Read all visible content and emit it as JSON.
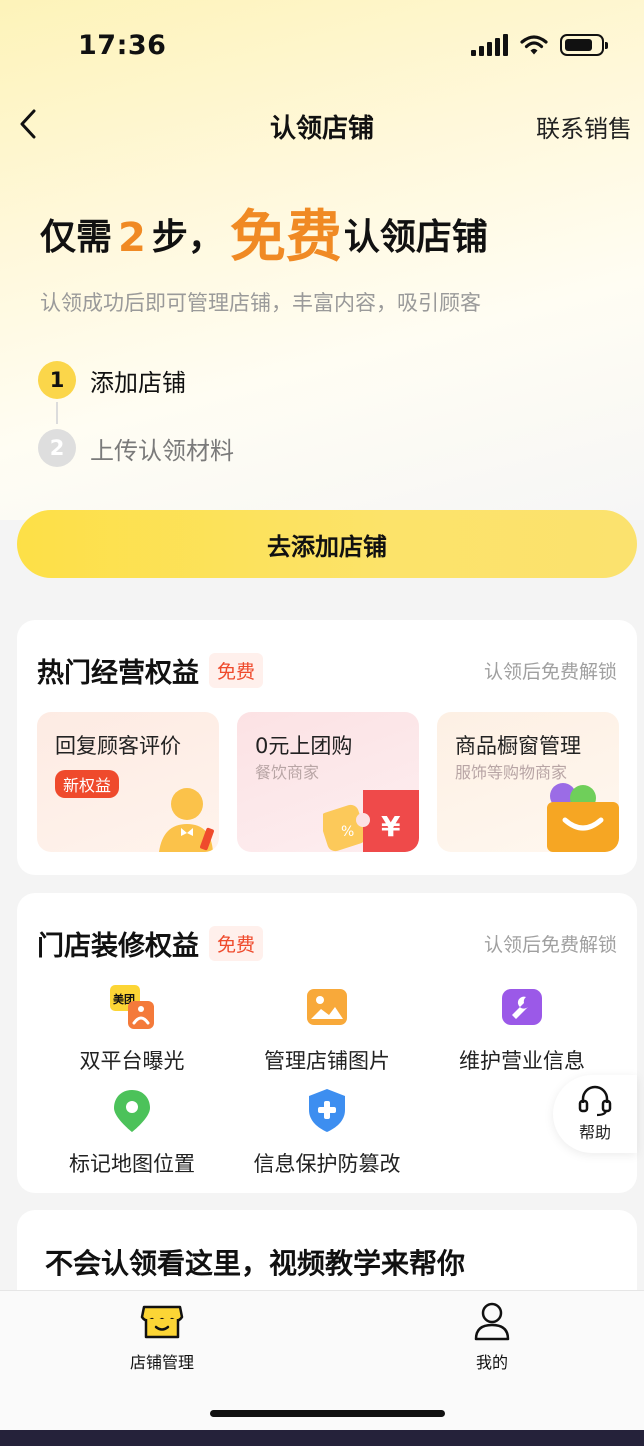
{
  "status_bar": {
    "time": "17:36"
  },
  "nav": {
    "title": "认领店铺",
    "right_action": "联系销售"
  },
  "headline": {
    "prefix": "仅需",
    "steps_count": "2",
    "steps_unit": "步，",
    "highlight": "免费",
    "suffix": "认领店铺"
  },
  "subtitle": "认领成功后即可管理店铺，丰富内容，吸引顾客",
  "steps": [
    {
      "num": "1",
      "label": "添加店铺",
      "active": true
    },
    {
      "num": "2",
      "label": "上传认领材料",
      "active": false
    }
  ],
  "cta_label": "去添加店铺",
  "hot_benefits": {
    "title": "热门经营权益",
    "badge": "免费",
    "right_text": "认领后免费解锁",
    "tiles": [
      {
        "title": "回复顾客评价",
        "badge": "新权益"
      },
      {
        "title": "0元上团购",
        "subtitle": "餐饮商家"
      },
      {
        "title": "商品橱窗管理",
        "subtitle": "服饰等购物商家"
      }
    ],
    "tile_icons": {
      "ticket_symbol": "¥",
      "coupon_symbol": "%"
    }
  },
  "decor_benefits": {
    "title": "门店装修权益",
    "badge": "免费",
    "right_text": "认领后免费解锁",
    "items": [
      {
        "label": "双平台曝光",
        "icon": "dual-platform-icon",
        "icon_text": "美团"
      },
      {
        "label": "管理店铺图片",
        "icon": "image-icon"
      },
      {
        "label": "维护营业信息",
        "icon": "wrench-icon"
      },
      {
        "label": "标记地图位置",
        "icon": "map-pin-icon"
      },
      {
        "label": "信息保护防篡改",
        "icon": "shield-icon"
      }
    ]
  },
  "help": {
    "label": "帮助"
  },
  "video_section": {
    "title": "不会认领看这里，视频教学来帮你"
  },
  "tabbar": {
    "tabs": [
      {
        "label": "店铺管理",
        "icon": "store-icon",
        "active": true
      },
      {
        "label": "我的",
        "icon": "user-icon",
        "active": false
      }
    ]
  },
  "colors": {
    "accent_orange": "#f08a24",
    "cta_yellow": "#fde047",
    "badge_red": "#ef4a2c"
  }
}
